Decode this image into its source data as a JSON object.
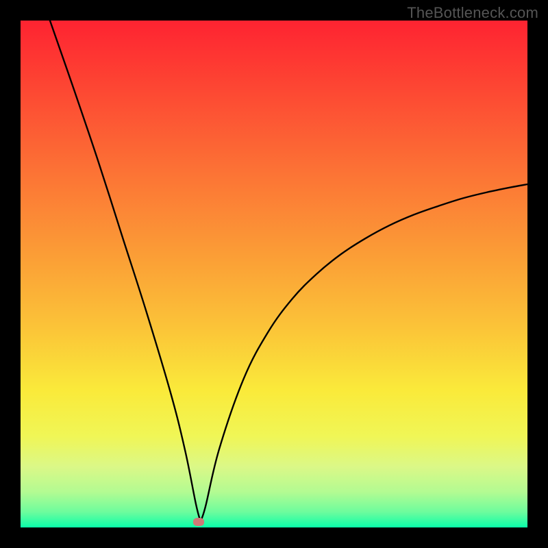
{
  "watermark": "TheBottleneck.com",
  "colors": {
    "frame": "#000000",
    "curve": "#000000",
    "marker": "#cf7a77",
    "gradient_stops": [
      {
        "pos": 0.0,
        "color": "#fe2331"
      },
      {
        "pos": 0.15,
        "color": "#fd4b33"
      },
      {
        "pos": 0.3,
        "color": "#fc7335"
      },
      {
        "pos": 0.45,
        "color": "#fb9a36"
      },
      {
        "pos": 0.6,
        "color": "#fbc238"
      },
      {
        "pos": 0.73,
        "color": "#faea3a"
      },
      {
        "pos": 0.82,
        "color": "#f0f656"
      },
      {
        "pos": 0.88,
        "color": "#dbf887"
      },
      {
        "pos": 0.93,
        "color": "#b3fb92"
      },
      {
        "pos": 0.97,
        "color": "#6cfc9d"
      },
      {
        "pos": 1.0,
        "color": "#0afea9"
      }
    ]
  },
  "chart_data": {
    "type": "line",
    "title": "",
    "xlabel": "",
    "ylabel": "",
    "xlim": [
      0,
      1
    ],
    "ylim": [
      0,
      1
    ],
    "grid": false,
    "description": "Bottleneck-style cusp curve. y is the bottleneck percentage (0 at bottom/green, 1 at top/red). Curve has a sharp minimum (cusp) near x≈0.355 at y≈0 where a small pink marker sits; left branch rises to y=1 at x≈0.06; right branch rises asymptotically toward y≈0.67 at x=1.",
    "series": [
      {
        "name": "bottleneck-curve",
        "points": [
          {
            "x": 0.058,
            "y": 1.0
          },
          {
            "x": 0.106,
            "y": 0.862
          },
          {
            "x": 0.154,
            "y": 0.72
          },
          {
            "x": 0.201,
            "y": 0.573
          },
          {
            "x": 0.249,
            "y": 0.423
          },
          {
            "x": 0.297,
            "y": 0.262
          },
          {
            "x": 0.325,
            "y": 0.15
          },
          {
            "x": 0.346,
            "y": 0.046
          },
          {
            "x": 0.355,
            "y": 0.012
          },
          {
            "x": 0.365,
            "y": 0.042
          },
          {
            "x": 0.392,
            "y": 0.155
          },
          {
            "x": 0.44,
            "y": 0.293
          },
          {
            "x": 0.488,
            "y": 0.385
          },
          {
            "x": 0.536,
            "y": 0.451
          },
          {
            "x": 0.584,
            "y": 0.5
          },
          {
            "x": 0.632,
            "y": 0.539
          },
          {
            "x": 0.68,
            "y": 0.57
          },
          {
            "x": 0.728,
            "y": 0.596
          },
          {
            "x": 0.776,
            "y": 0.617
          },
          {
            "x": 0.824,
            "y": 0.634
          },
          {
            "x": 0.871,
            "y": 0.649
          },
          {
            "x": 0.919,
            "y": 0.661
          },
          {
            "x": 0.967,
            "y": 0.671
          },
          {
            "x": 1.0,
            "y": 0.677
          }
        ]
      }
    ],
    "marker": {
      "x": 0.351,
      "y": 0.011
    }
  }
}
